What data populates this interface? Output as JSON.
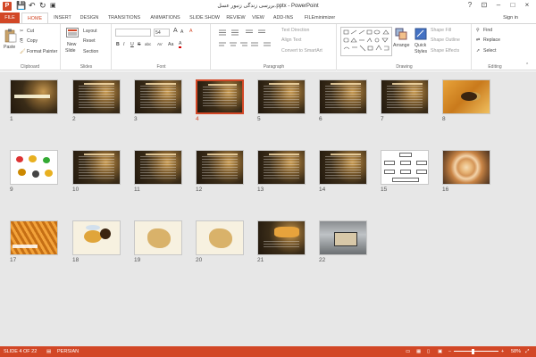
{
  "app": {
    "title": "بررسی زندگی زنبور عسل.pptx - PowerPoint",
    "logo_letter": "P",
    "accent": "#d24726"
  },
  "qat": {
    "save_icon": "💾",
    "undo_icon": "↶",
    "redo_icon": "↻",
    "present_icon": "▣"
  },
  "window": {
    "help": "?",
    "ribbon_opts": "⊡",
    "minimize": "–",
    "maximize": "□",
    "close": "×",
    "signin": "Sign in"
  },
  "tabs": [
    "FILE",
    "HOME",
    "INSERT",
    "DESIGN",
    "TRANSITIONS",
    "ANIMATIONS",
    "SLIDE SHOW",
    "REVIEW",
    "VIEW",
    "ADD-INS",
    "FILEminimizer"
  ],
  "ribbon": {
    "clipboard": {
      "paste": "Paste",
      "cut": "Cut",
      "copy": "Copy",
      "format_painter": "Format Painter",
      "label": "Clipboard"
    },
    "slides": {
      "new_slide": "New",
      "new_slide2": "Slide",
      "layout": "Layout",
      "reset": "Reset",
      "section": "Section",
      "label": "Slides"
    },
    "font": {
      "size": "54",
      "bold": "B",
      "italic": "I",
      "underline": "U",
      "strike": "S",
      "shadow": "abc",
      "spacing": "AV",
      "case": "Aa",
      "font_color": "A",
      "grow": "A",
      "shrink": "A",
      "clear": "A",
      "label": "Font"
    },
    "paragraph": {
      "text_direction": "Text Direction",
      "align_text": "Align Text",
      "convert_smartart": "Convert to SmartArt",
      "label": "Paragraph"
    },
    "drawing": {
      "arrange": "Arrange",
      "quick_styles": "Quick",
      "quick_styles2": "Styles",
      "shape_fill": "Shape Fill",
      "shape_outline": "Shape Outline",
      "shape_effects": "Shape Effects",
      "label": "Drawing"
    },
    "editing": {
      "find": "Find",
      "replace": "Replace",
      "select": "Select",
      "label": "Editing"
    }
  },
  "slides": [
    "1",
    "2",
    "3",
    "4",
    "5",
    "6",
    "7",
    "8",
    "9",
    "10",
    "11",
    "12",
    "13",
    "14",
    "15",
    "16",
    "17",
    "18",
    "19",
    "20",
    "21",
    "22"
  ],
  "selected_slide": "4",
  "status": {
    "slide_info": "SLIDE 4 OF 22",
    "language": "PERSIAN",
    "zoom": "58%",
    "zoom_minus": "–",
    "zoom_plus": "+"
  }
}
